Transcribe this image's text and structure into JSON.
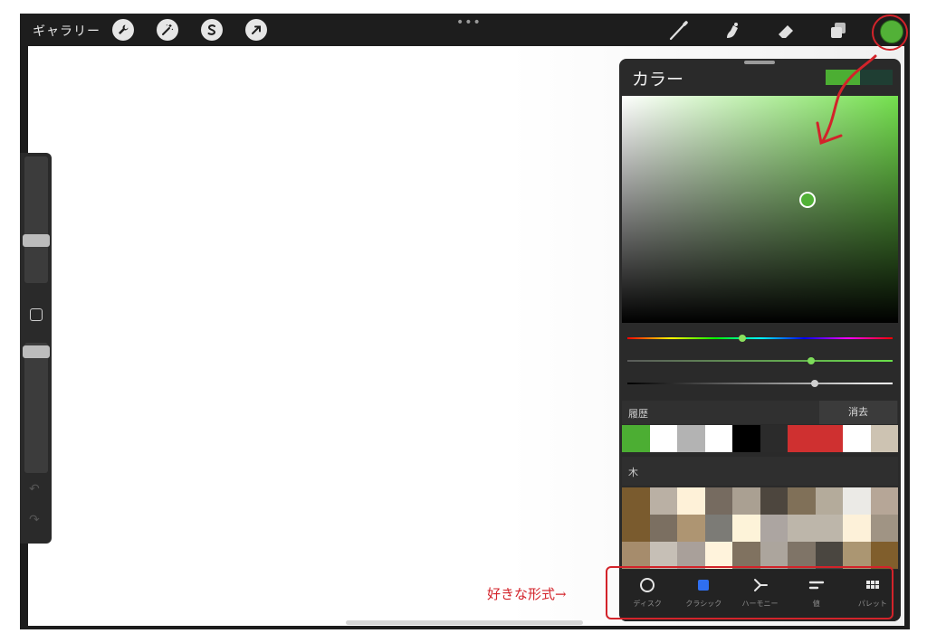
{
  "topbar": {
    "gallery_label": "ギャラリー",
    "more_label": "•••",
    "tools": [
      "wrench-icon",
      "magic-wand-icon",
      "selection-icon",
      "transform-arrow-icon"
    ],
    "right_tools": [
      "brush-icon",
      "smudge-icon",
      "eraser-icon",
      "layers-icon"
    ],
    "current_color": "#52b137"
  },
  "color_panel": {
    "title": "カラー",
    "new_swatch": "#4cae33",
    "old_swatch": "#1f3e33",
    "history_label": "履歴",
    "clear_label": "消去",
    "history_colors": [
      "#4cae33",
      "#ffffff",
      "#b3b3b3",
      "#ffffff",
      "#000000",
      "#2b2b2b",
      "#cf3030",
      "#cf3030",
      "#ffffff",
      "#cdc3b2"
    ],
    "palette_label": "木",
    "palette_colors": [
      "#7a5b2e",
      "#bab0a4",
      "#fef1d8",
      "#766b60",
      "#aaa092",
      "#4d463e",
      "#807058",
      "#b4ab9b",
      "#ebeae6",
      "#b6a697",
      "#7a5b2e",
      "#7b6f61",
      "#ae9572",
      "#7c7b76",
      "#fdf3d9",
      "#aca5a1",
      "#bdb6aa",
      "#bdb6aa",
      "#fdf1d9",
      "#a09484",
      "#a68c6c",
      "#c6bfb6",
      "#a9a09a",
      "#fff3dc",
      "#807260",
      "#aca59d",
      "#7f7467",
      "#4a4640",
      "#ab9672",
      "#805e2c"
    ],
    "tabs": [
      {
        "label": "ディスク",
        "icon": "disc-icon"
      },
      {
        "label": "クラシック",
        "icon": "classic-square-icon"
      },
      {
        "label": "ハーモニー",
        "icon": "harmony-icon"
      },
      {
        "label": "値",
        "icon": "value-sliders-icon"
      },
      {
        "label": "パレット",
        "icon": "palette-grid-icon"
      }
    ],
    "active_tab": "クラシック",
    "accent": "#2f6ff0"
  },
  "annotation": {
    "text": "好きな形式→",
    "color": "#d3232a"
  }
}
